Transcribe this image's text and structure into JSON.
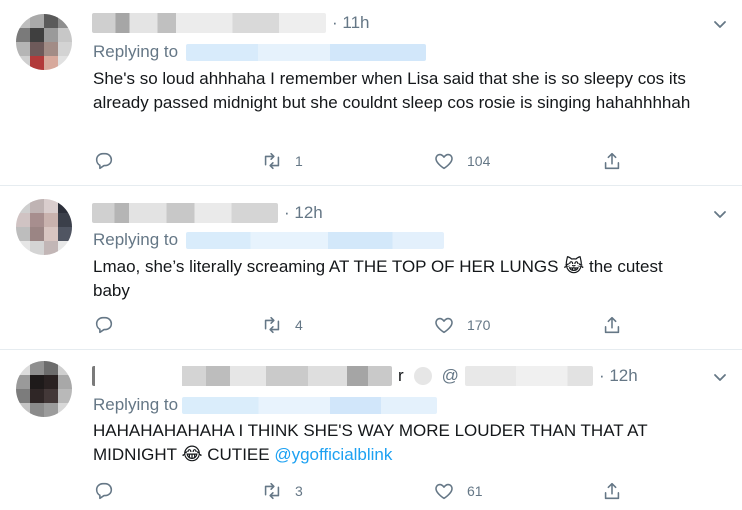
{
  "colors": {
    "muted": "#657786",
    "link": "#1da1f2",
    "text": "#14171a",
    "border": "#e6ecf0"
  },
  "tweets": [
    {
      "time": "· 11h",
      "replying_label": "Replying to",
      "text": "She's so loud ahhhaha I remember when Lisa said that she is so sleepy cos its already passed midnight but she couldnt sleep cos rosie is singing hahahhhhah",
      "emoji": "",
      "text_after_emoji": "",
      "mention": "",
      "replies": "",
      "retweets": "1",
      "likes": "104"
    },
    {
      "time": "· 12h",
      "replying_label": "Replying to",
      "text": "Lmao, she’s literally screaming AT THE TOP OF HER LUNGS",
      "emoji": "😹",
      "text_after_emoji": " the cutest baby",
      "mention": "",
      "replies": "",
      "retweets": "4",
      "likes": "170"
    },
    {
      "time": "· 12h",
      "handle_prefix": "@",
      "name_fragment": "r",
      "replying_label": "Replying to",
      "text": "HAHAHAHAHAHA I THINK SHE'S WAY MORE LOUDER THAN THAT AT MIDNIGHT",
      "emoji": "😂",
      "text_after_emoji": " CUTIEE ",
      "mention": "@ygofficialblink",
      "replies": "",
      "retweets": "3",
      "likes": "61"
    }
  ]
}
